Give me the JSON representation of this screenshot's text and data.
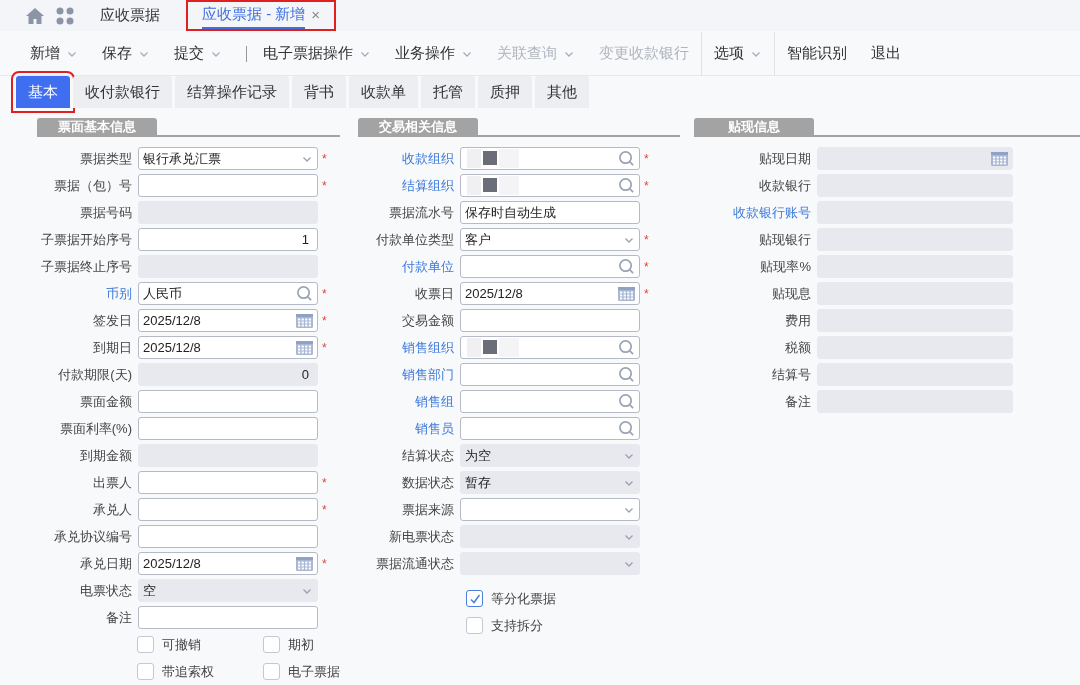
{
  "nav": {
    "tabs": [
      {
        "label": "应收票据",
        "selected": false,
        "highlighted": false
      },
      {
        "label": "应收票据 - 新增",
        "selected": true,
        "highlighted": true,
        "close": "×"
      }
    ]
  },
  "toolbar": [
    {
      "label": "新增",
      "dropdown": true,
      "disabled": false,
      "boxed": false,
      "divider_before": false
    },
    {
      "label": "保存",
      "dropdown": true,
      "disabled": false,
      "boxed": false,
      "divider_before": false
    },
    {
      "label": "提交",
      "dropdown": true,
      "disabled": false,
      "boxed": false,
      "divider_before": false
    },
    {
      "label": "电子票据操作",
      "dropdown": true,
      "disabled": false,
      "boxed": false,
      "divider_before": true
    },
    {
      "label": "业务操作",
      "dropdown": true,
      "disabled": false,
      "boxed": false,
      "divider_before": false
    },
    {
      "label": "关联查询",
      "dropdown": true,
      "disabled": true,
      "boxed": false,
      "divider_before": false
    },
    {
      "label": "变更收款银行",
      "dropdown": false,
      "disabled": true,
      "boxed": false,
      "divider_before": false
    },
    {
      "label": "选项",
      "dropdown": true,
      "disabled": false,
      "boxed": true,
      "divider_before": false
    },
    {
      "label": "智能识别",
      "dropdown": false,
      "disabled": false,
      "boxed": false,
      "divider_before": false
    },
    {
      "label": "退出",
      "dropdown": false,
      "disabled": false,
      "boxed": false,
      "divider_before": false
    }
  ],
  "subtabs": [
    {
      "label": "基本",
      "selected": true,
      "highlighted": true
    },
    {
      "label": "收付款银行",
      "selected": false,
      "highlighted": false
    },
    {
      "label": "结算操作记录",
      "selected": false,
      "highlighted": false
    },
    {
      "label": "背书",
      "selected": false,
      "highlighted": false
    },
    {
      "label": "收款单",
      "selected": false,
      "highlighted": false
    },
    {
      "label": "托管",
      "selected": false,
      "highlighted": false
    },
    {
      "label": "质押",
      "selected": false,
      "highlighted": false
    },
    {
      "label": "其他",
      "selected": false,
      "highlighted": false
    }
  ],
  "sections": [
    {
      "title": "票面基本信息",
      "fields": [
        {
          "label": "票据类型",
          "kind": "select",
          "value": "银行承兑汇票",
          "required": "*",
          "link": false,
          "disabled": false
        },
        {
          "label": "票据（包）号",
          "kind": "text",
          "required": "*",
          "link": false,
          "disabled": false
        },
        {
          "label": "票据号码",
          "kind": "text",
          "link": false,
          "disabled": true
        },
        {
          "label": "子票据开始序号",
          "kind": "number",
          "value": "1",
          "link": false,
          "disabled": false
        },
        {
          "label": "子票据终止序号",
          "kind": "text",
          "link": false,
          "disabled": true
        },
        {
          "label": "币别",
          "kind": "lookup",
          "value": "人民币",
          "required": "*",
          "link": true,
          "disabled": false
        },
        {
          "label": "签发日",
          "kind": "date",
          "value": "2025/12/8",
          "required": "*",
          "link": false,
          "disabled": false
        },
        {
          "label": "到期日",
          "kind": "date",
          "value": "2025/12/8",
          "required": "*",
          "link": false,
          "disabled": false
        },
        {
          "label": "付款期限(天)",
          "kind": "number",
          "value": "0",
          "link": false,
          "disabled": true
        },
        {
          "label": "票面金额",
          "kind": "text",
          "link": false,
          "disabled": false
        },
        {
          "label": "票面利率(%)",
          "kind": "text",
          "link": false,
          "disabled": false
        },
        {
          "label": "到期金额",
          "kind": "text",
          "link": false,
          "disabled": true
        },
        {
          "label": "出票人",
          "kind": "text",
          "required": "*",
          "link": false,
          "disabled": false
        },
        {
          "label": "承兑人",
          "kind": "text",
          "required": "*",
          "link": false,
          "disabled": false
        },
        {
          "label": "承兑协议编号",
          "kind": "text",
          "link": false,
          "disabled": false
        },
        {
          "label": "承兑日期",
          "kind": "date",
          "value": "2025/12/8",
          "required": "*",
          "link": false,
          "disabled": false
        },
        {
          "label": "电票状态",
          "kind": "select",
          "value": "空",
          "link": false,
          "disabled": true
        },
        {
          "label": "备注",
          "kind": "text",
          "link": false,
          "disabled": false
        }
      ],
      "checkbox_rows": [
        [
          {
            "label": "可撤销",
            "checked": false
          },
          {
            "label": "期初",
            "checked": false
          }
        ],
        [
          {
            "label": "带追索权",
            "checked": false
          },
          {
            "label": "电子票据",
            "checked": false
          }
        ]
      ]
    },
    {
      "title": "交易相关信息",
      "fields": [
        {
          "label": "收款组织",
          "kind": "lookup",
          "redacted": true,
          "required": "*",
          "link": true,
          "disabled": false
        },
        {
          "label": "结算组织",
          "kind": "lookup",
          "redacted": true,
          "required": "*",
          "link": true,
          "disabled": false
        },
        {
          "label": "票据流水号",
          "kind": "text",
          "value": "保存时自动生成",
          "link": false,
          "disabled": false
        },
        {
          "label": "付款单位类型",
          "kind": "select",
          "value": "客户",
          "required": "*",
          "link": false,
          "disabled": false
        },
        {
          "label": "付款单位",
          "kind": "lookup",
          "required": "*",
          "link": true,
          "disabled": false
        },
        {
          "label": "收票日",
          "kind": "date",
          "value": "2025/12/8",
          "required": "*",
          "link": false,
          "disabled": false
        },
        {
          "label": "交易金额",
          "kind": "text",
          "link": false,
          "disabled": false
        },
        {
          "label": "销售组织",
          "kind": "lookup",
          "redacted": true,
          "link": true,
          "disabled": false
        },
        {
          "label": "销售部门",
          "kind": "lookup",
          "link": true,
          "disabled": false
        },
        {
          "label": "销售组",
          "kind": "lookup",
          "link": true,
          "disabled": false
        },
        {
          "label": "销售员",
          "kind": "lookup",
          "link": true,
          "disabled": false
        },
        {
          "label": "结算状态",
          "kind": "select",
          "value": "为空",
          "link": false,
          "disabled": true
        },
        {
          "label": "数据状态",
          "kind": "select",
          "value": "暂存",
          "link": false,
          "disabled": true
        },
        {
          "label": "票据来源",
          "kind": "select",
          "link": false,
          "disabled": false
        },
        {
          "label": "新电票状态",
          "kind": "select",
          "link": false,
          "disabled": true
        },
        {
          "label": "票据流通状态",
          "kind": "select",
          "link": false,
          "disabled": true
        }
      ],
      "checkbox_rows": [
        [
          {
            "label": "等分化票据",
            "checked": true
          }
        ],
        [
          {
            "label": "支持拆分",
            "checked": false
          }
        ]
      ]
    },
    {
      "title": "贴现信息",
      "fields": [
        {
          "label": "贴现日期",
          "kind": "date",
          "link": false,
          "disabled": true
        },
        {
          "label": "收款银行",
          "kind": "text",
          "link": false,
          "disabled": true
        },
        {
          "label": "收款银行账号",
          "kind": "text",
          "link": true,
          "disabled": true
        },
        {
          "label": "贴现银行",
          "kind": "text",
          "link": false,
          "disabled": true
        },
        {
          "label": "贴现率%",
          "kind": "text",
          "link": false,
          "disabled": true
        },
        {
          "label": "贴现息",
          "kind": "text",
          "link": false,
          "disabled": true
        },
        {
          "label": "费用",
          "kind": "text",
          "link": false,
          "disabled": true
        },
        {
          "label": "税额",
          "kind": "text",
          "link": false,
          "disabled": true
        },
        {
          "label": "结算号",
          "kind": "text",
          "link": false,
          "disabled": true
        },
        {
          "label": "备注",
          "kind": "text",
          "link": false,
          "disabled": true
        }
      ]
    }
  ]
}
